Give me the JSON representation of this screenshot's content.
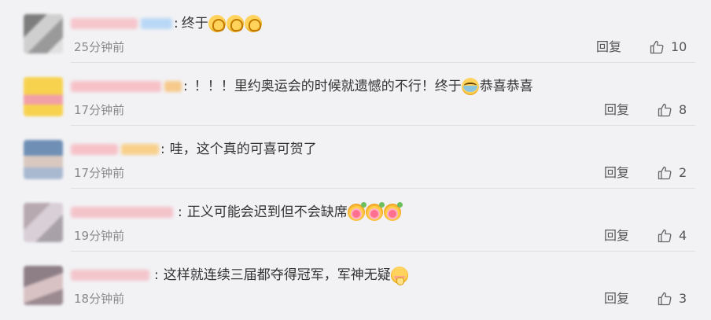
{
  "comments": [
    {
      "text": "终于",
      "emojis": [
        "clap-emoji",
        "clap-emoji",
        "clap-emoji"
      ],
      "time": "25分钟前",
      "reply_label": "回复",
      "likes": "10",
      "avatar_colors": [
        "#8a8a8a",
        "#c9c9c9"
      ],
      "name_colors": [
        "#f5c6cc",
        "#b9d8f5"
      ]
    },
    {
      "text": "！！！里约奥运会的时候就遗憾的不行！终于",
      "text_after": "恭喜恭喜",
      "emojis": [
        "cry-emoji"
      ],
      "time": "17分钟前",
      "reply_label": "回复",
      "likes": "8",
      "avatar_colors": [
        "#f7d24f",
        "#f2a0a8"
      ],
      "name_colors": [
        "#f6c2c8",
        "#f7c98a"
      ]
    },
    {
      "text": "哇，这个真的可喜可贺了",
      "emojis": [],
      "time": "17分钟前",
      "reply_label": "回复",
      "likes": "2",
      "avatar_colors": [
        "#6f8fb5",
        "#d8c8c0"
      ],
      "name_colors": [
        "#f6c2c8",
        "#f8d08a"
      ]
    },
    {
      "text": "正义可能会迟到但不会缺席",
      "emojis": [
        "flower-emoji",
        "flower-emoji",
        "flower-emoji"
      ],
      "time": "19分钟前",
      "reply_label": "回复",
      "likes": "4",
      "avatar_colors": [
        "#b7a9b0",
        "#d9cfd6"
      ],
      "name_colors": [
        "#f3c3ca",
        "#e9cfd8"
      ]
    },
    {
      "text": "这样就连续三届都夺得冠军，军神无疑",
      "emojis": [
        "blush-emoji"
      ],
      "time": "18分钟前",
      "reply_label": "回复",
      "likes": "3",
      "avatar_colors": [
        "#8e7f86",
        "#d8c2c4"
      ],
      "name_colors": [
        "#f3c6cc",
        "#ead7db"
      ]
    }
  ],
  "colors": {
    "background": "#f2f2f5",
    "text": "#333333",
    "muted": "#8a8a8a"
  }
}
